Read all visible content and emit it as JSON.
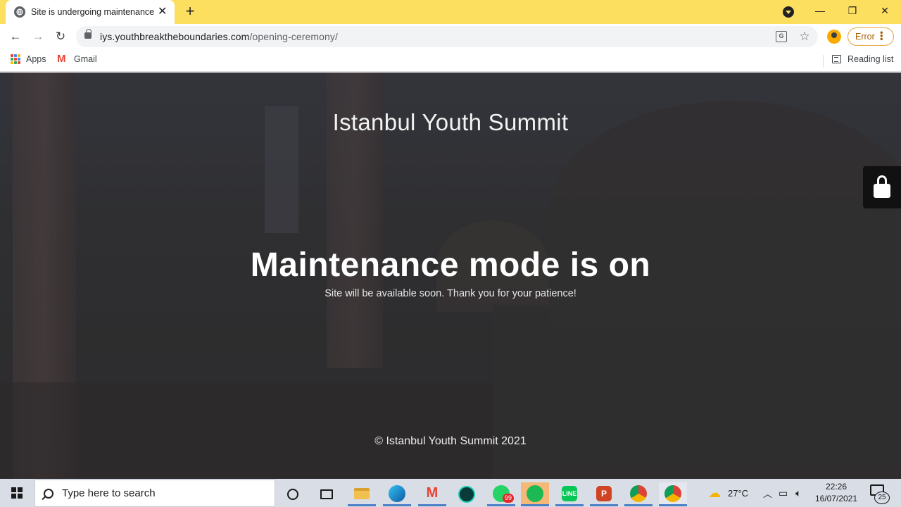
{
  "browser": {
    "tab_title": "Site is undergoing maintenance",
    "tab_close": "✕",
    "new_tab": "+",
    "window_controls": {
      "minimize": "—",
      "restore": "❐",
      "close": "✕"
    },
    "url_host": "iys.youthbreaktheboundaries.com",
    "url_path": "/opening-ceremony/",
    "error_label": "Error",
    "translate_glyph": "G",
    "star_glyph": "☆",
    "back_glyph": "←",
    "forward_glyph": "→",
    "reload_glyph": "↻"
  },
  "bookmarks": {
    "apps": "Apps",
    "gmail": "Gmail",
    "reading_list": "Reading list"
  },
  "page": {
    "site_title": "Istanbul Youth Summit",
    "headline": "Maintenance mode is on",
    "subline": "Site will be available soon. Thank you for your patience!",
    "copyright": "© Istanbul Youth Summit 2021"
  },
  "taskbar": {
    "search_placeholder": "Type here to search",
    "whatsapp_badge": "99",
    "weather_temp": "27°C",
    "time": "22:26",
    "date": "16/07/2021",
    "notification_count": "25",
    "icons": [
      "cortana-icon",
      "task-view-icon",
      "file-explorer-icon",
      "edge-icon",
      "gmail-icon",
      "gitkraken-icon",
      "whatsapp-icon",
      "spotify-icon",
      "line-icon",
      "powerpoint-icon",
      "chrome-icon",
      "chrome-profile-icon"
    ]
  },
  "colors": {
    "tab_bar": "#fddf5f",
    "error_accent": "#e8a33d",
    "taskbar": "#d9dde6"
  }
}
